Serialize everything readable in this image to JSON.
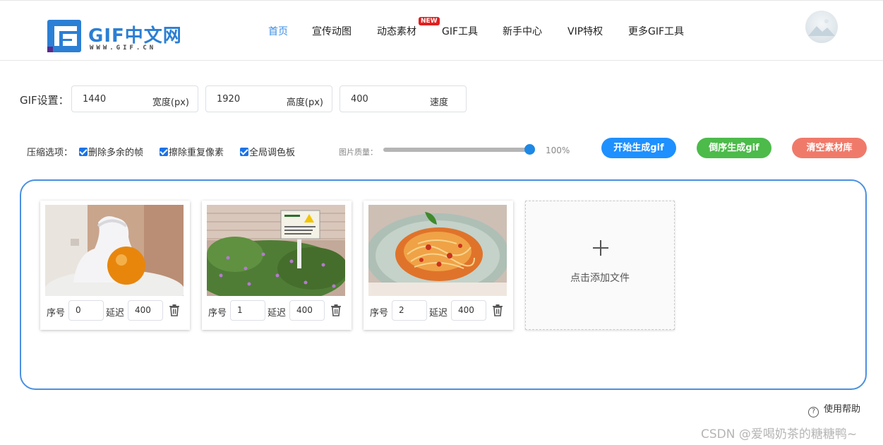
{
  "header": {
    "logo_title": "GIF中文网",
    "logo_sub": "WWW.GIF.CN",
    "nav": [
      {
        "label": "首页",
        "active": true
      },
      {
        "label": "宣传动图",
        "active": false
      },
      {
        "label": "动态素材",
        "active": false
      },
      {
        "label": "GIF工具",
        "active": false
      },
      {
        "label": "新手中心",
        "active": false
      },
      {
        "label": "VIP特权",
        "active": false
      },
      {
        "label": "更多GIF工具",
        "active": false
      }
    ],
    "new_badge": "NEW"
  },
  "settings": {
    "label": "GIF设置：",
    "width": {
      "value": "1440",
      "unit": "宽度(px)"
    },
    "height": {
      "value": "1920",
      "unit": "高度(px)"
    },
    "speed": {
      "value": "400",
      "unit": "速度"
    }
  },
  "compress": {
    "label": "压缩选项：",
    "options": [
      {
        "label": "删除多余的帧",
        "checked": true
      },
      {
        "label": "擦除重复像素",
        "checked": true
      },
      {
        "label": "全局调色板",
        "checked": true
      }
    ],
    "quality_label": "图片质量：",
    "quality_value": "100%",
    "quality_level": 1.0
  },
  "buttons": {
    "start": {
      "label": "开始生成gif",
      "color": "#1e90ff"
    },
    "reverse": {
      "label": "倒序生成gif",
      "color": "#4cbb4a"
    },
    "clear": {
      "label": "清空素材库",
      "color": "#f07a6a"
    }
  },
  "frames": [
    {
      "order_label": "序号",
      "order": "0",
      "delay_label": "延迟",
      "delay": "400",
      "image": "statue-with-orange-ball"
    },
    {
      "order_label": "序号",
      "order": "1",
      "delay_label": "延迟",
      "delay": "400",
      "image": "flowers-with-sign"
    },
    {
      "order_label": "序号",
      "order": "2",
      "delay_label": "延迟",
      "delay": "400",
      "image": "spaghetti-plate"
    }
  ],
  "add_card": {
    "label": "点击添加文件"
  },
  "help": {
    "label": "使用帮助",
    "icon": "?"
  },
  "watermark": "CSDN @爱喝奶茶的糖糖鸭~"
}
